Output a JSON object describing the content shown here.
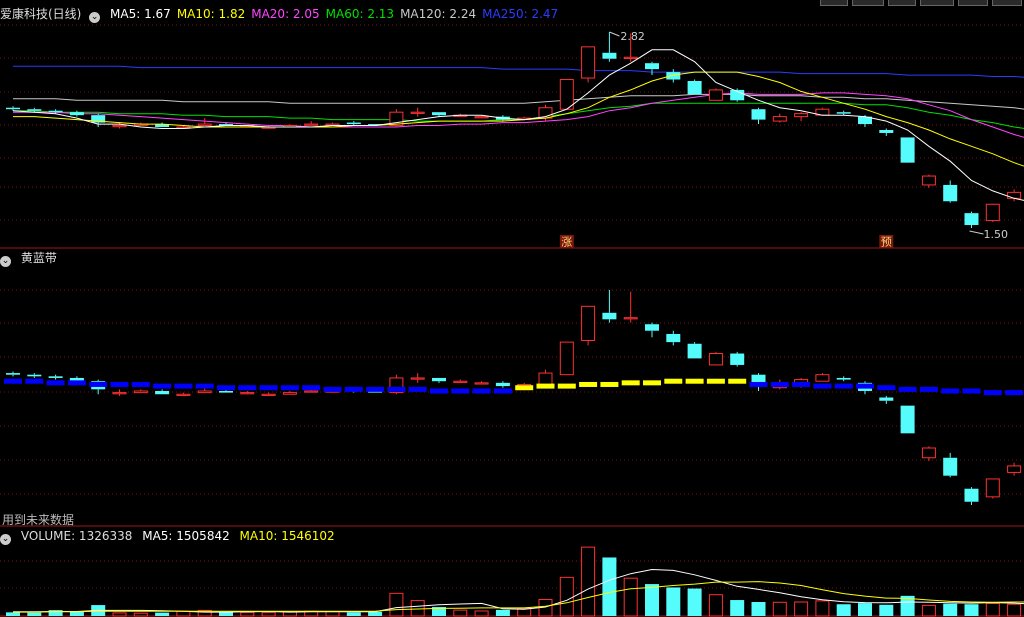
{
  "panel1": {
    "title": "爱康科技(日线)",
    "ma_labels": [
      {
        "label": "MA5: 1.67",
        "color": "#ffffff"
      },
      {
        "label": "MA10: 1.82",
        "color": "#ffff00"
      },
      {
        "label": "MA20: 2.05",
        "color": "#ff44ff"
      },
      {
        "label": "MA60: 2.13",
        "color": "#00e000"
      },
      {
        "label": "MA120: 2.24",
        "color": "#c8c8c8"
      },
      {
        "label": "MA250: 2.47",
        "color": "#2a3cff"
      }
    ],
    "high_label": "2.82",
    "low_label": "1.50",
    "tag_limit_up": "涨",
    "tag_forecast": "预"
  },
  "panel2": {
    "title": "黄蓝带",
    "footer_note": "用到未来数据"
  },
  "panel3": {
    "title": "VOLUME: 1326338",
    "ma5_label": "MA5: 1505842",
    "ma10_label": "MA10: 1546102"
  },
  "colors": {
    "up": "#ff3030",
    "down": "#54fcfc",
    "grid": "#7a1010",
    "ma5": "#ffffff",
    "ma10": "#ffff00",
    "ma20": "#ff44ff",
    "ma60": "#00e000",
    "ma120": "#c8c8c8",
    "ma250": "#2a3cff",
    "band_yellow": "#ffff00",
    "band_blue": "#0000ff"
  },
  "chart_data": {
    "type": "candlestick",
    "candles": [
      [
        2.31,
        2.3,
        2.32,
        2.29
      ],
      [
        2.3,
        2.29,
        2.31,
        2.28
      ],
      [
        2.29,
        2.28,
        2.3,
        2.27
      ],
      [
        2.28,
        2.26,
        2.29,
        2.25
      ],
      [
        2.26,
        2.21,
        2.27,
        2.18
      ],
      [
        2.19,
        2.19,
        2.21,
        2.17
      ],
      [
        2.19,
        2.2,
        2.21,
        2.19
      ],
      [
        2.2,
        2.18,
        2.21,
        2.18
      ],
      [
        2.18,
        2.18,
        2.19,
        2.18
      ],
      [
        2.19,
        2.2,
        2.24,
        2.19
      ],
      [
        2.2,
        2.19,
        2.21,
        2.19
      ],
      [
        2.19,
        2.19,
        2.2,
        2.18
      ],
      [
        2.18,
        2.18,
        2.19,
        2.17
      ],
      [
        2.18,
        2.19,
        2.2,
        2.18
      ],
      [
        2.2,
        2.2,
        2.22,
        2.2
      ],
      [
        2.2,
        2.2,
        2.21,
        2.19
      ],
      [
        2.21,
        2.2,
        2.22,
        2.19
      ],
      [
        2.2,
        2.19,
        2.2,
        2.19
      ],
      [
        2.19,
        2.28,
        2.3,
        2.18
      ],
      [
        2.28,
        2.28,
        2.31,
        2.25
      ],
      [
        2.28,
        2.26,
        2.28,
        2.25
      ],
      [
        2.26,
        2.26,
        2.27,
        2.25
      ],
      [
        2.25,
        2.25,
        2.26,
        2.24
      ],
      [
        2.25,
        2.23,
        2.26,
        2.22
      ],
      [
        2.23,
        2.24,
        2.25,
        2.23
      ],
      [
        2.24,
        2.31,
        2.33,
        2.22
      ],
      [
        2.3,
        2.5,
        2.5,
        2.3
      ],
      [
        2.51,
        2.72,
        2.72,
        2.48
      ],
      [
        2.68,
        2.64,
        2.82,
        2.62
      ],
      [
        2.65,
        2.65,
        2.81,
        2.62
      ],
      [
        2.61,
        2.57,
        2.62,
        2.53
      ],
      [
        2.55,
        2.5,
        2.57,
        2.48
      ],
      [
        2.49,
        2.4,
        2.5,
        2.4
      ],
      [
        2.36,
        2.43,
        2.44,
        2.36
      ],
      [
        2.43,
        2.36,
        2.44,
        2.35
      ],
      [
        2.3,
        2.23,
        2.31,
        2.2
      ],
      [
        2.22,
        2.25,
        2.27,
        2.21
      ],
      [
        2.25,
        2.27,
        2.28,
        2.22
      ],
      [
        2.26,
        2.3,
        2.31,
        2.26
      ],
      [
        2.28,
        2.27,
        2.29,
        2.26
      ],
      [
        2.25,
        2.2,
        2.26,
        2.18
      ],
      [
        2.16,
        2.14,
        2.17,
        2.12
      ],
      [
        2.11,
        1.94,
        2.11,
        1.94
      ],
      [
        1.79,
        1.85,
        1.86,
        1.77
      ],
      [
        1.79,
        1.68,
        1.82,
        1.67
      ],
      [
        1.6,
        1.52,
        1.61,
        1.5
      ],
      [
        1.55,
        1.66,
        1.66,
        1.54
      ],
      [
        1.7,
        1.74,
        1.76,
        1.68
      ],
      [
        1.82,
        1.79,
        1.84,
        1.77
      ]
    ],
    "ma5": [
      2.29,
      2.28,
      2.27,
      2.24,
      2.2,
      2.2,
      2.18,
      2.17,
      2.17,
      2.18,
      2.19,
      2.19,
      2.18,
      2.18,
      2.18,
      2.19,
      2.19,
      2.19,
      2.21,
      2.23,
      2.25,
      2.26,
      2.26,
      2.24,
      2.23,
      2.25,
      2.3,
      2.41,
      2.53,
      2.61,
      2.7,
      2.7,
      2.62,
      2.48,
      2.42,
      2.36,
      2.31,
      2.29,
      2.26,
      2.26,
      2.25,
      2.22,
      2.16,
      2.05,
      1.95,
      1.82,
      1.75,
      1.7,
      1.67
    ],
    "ma10": [
      2.25,
      2.25,
      2.24,
      2.23,
      2.22,
      2.21,
      2.2,
      2.2,
      2.19,
      2.18,
      2.18,
      2.18,
      2.18,
      2.18,
      2.18,
      2.18,
      2.19,
      2.19,
      2.2,
      2.21,
      2.22,
      2.22,
      2.22,
      2.22,
      2.23,
      2.24,
      2.27,
      2.31,
      2.38,
      2.43,
      2.49,
      2.53,
      2.55,
      2.55,
      2.55,
      2.52,
      2.48,
      2.42,
      2.38,
      2.34,
      2.3,
      2.25,
      2.21,
      2.16,
      2.1,
      2.05,
      2.0,
      1.94,
      1.89
    ],
    "ma20": [
      2.28,
      2.28,
      2.28,
      2.27,
      2.27,
      2.26,
      2.25,
      2.24,
      2.23,
      2.22,
      2.21,
      2.2,
      2.19,
      2.19,
      2.18,
      2.18,
      2.18,
      2.18,
      2.18,
      2.19,
      2.19,
      2.2,
      2.2,
      2.21,
      2.21,
      2.22,
      2.23,
      2.25,
      2.29,
      2.31,
      2.34,
      2.36,
      2.38,
      2.4,
      2.41,
      2.4,
      2.4,
      2.4,
      2.41,
      2.41,
      2.4,
      2.39,
      2.37,
      2.33,
      2.29,
      2.23,
      2.18,
      2.13,
      2.09
    ],
    "ma60": [
      2.29,
      2.29,
      2.28,
      2.28,
      2.28,
      2.27,
      2.27,
      2.27,
      2.26,
      2.26,
      2.25,
      2.25,
      2.25,
      2.24,
      2.24,
      2.23,
      2.23,
      2.23,
      2.23,
      2.22,
      2.22,
      2.22,
      2.22,
      2.23,
      2.23,
      2.25,
      2.27,
      2.29,
      2.31,
      2.32,
      2.34,
      2.34,
      2.34,
      2.34,
      2.34,
      2.34,
      2.34,
      2.34,
      2.34,
      2.34,
      2.33,
      2.33,
      2.31,
      2.28,
      2.26,
      2.23,
      2.21,
      2.18,
      2.16
    ],
    "ma120": [
      2.37,
      2.37,
      2.37,
      2.36,
      2.36,
      2.36,
      2.36,
      2.36,
      2.35,
      2.35,
      2.35,
      2.35,
      2.35,
      2.34,
      2.34,
      2.34,
      2.34,
      2.34,
      2.34,
      2.34,
      2.34,
      2.34,
      2.34,
      2.34,
      2.34,
      2.35,
      2.36,
      2.37,
      2.38,
      2.39,
      2.39,
      2.39,
      2.4,
      2.4,
      2.4,
      2.39,
      2.39,
      2.39,
      2.38,
      2.38,
      2.37,
      2.37,
      2.36,
      2.35,
      2.34,
      2.33,
      2.32,
      2.31,
      2.29
    ],
    "ma250": [
      2.59,
      2.59,
      2.59,
      2.59,
      2.59,
      2.59,
      2.58,
      2.58,
      2.58,
      2.58,
      2.58,
      2.58,
      2.58,
      2.58,
      2.58,
      2.58,
      2.58,
      2.58,
      2.58,
      2.58,
      2.58,
      2.58,
      2.58,
      2.57,
      2.57,
      2.57,
      2.57,
      2.56,
      2.56,
      2.56,
      2.55,
      2.55,
      2.55,
      2.55,
      2.55,
      2.55,
      2.55,
      2.54,
      2.54,
      2.54,
      2.54,
      2.54,
      2.53,
      2.53,
      2.53,
      2.53,
      2.52,
      2.52,
      2.51
    ],
    "band_level": [
      2.26,
      2.26,
      2.25,
      2.25,
      2.24,
      2.24,
      2.24,
      2.23,
      2.23,
      2.23,
      2.22,
      2.22,
      2.22,
      2.22,
      2.22,
      2.21,
      2.21,
      2.21,
      2.21,
      2.21,
      2.2,
      2.2,
      2.2,
      2.2,
      2.22,
      2.23,
      2.23,
      2.24,
      2.24,
      2.25,
      2.25,
      2.26,
      2.26,
      2.26,
      2.26,
      2.24,
      2.24,
      2.24,
      2.23,
      2.23,
      2.23,
      2.22,
      2.21,
      2.21,
      2.2,
      2.2,
      2.19,
      2.19,
      2.18
    ],
    "band_color": [
      "b",
      "b",
      "b",
      "b",
      "b",
      "b",
      "b",
      "b",
      "b",
      "b",
      "b",
      "b",
      "b",
      "b",
      "b",
      "b",
      "b",
      "b",
      "b",
      "b",
      "b",
      "b",
      "b",
      "b",
      "y",
      "y",
      "y",
      "y",
      "y",
      "y",
      "y",
      "y",
      "y",
      "y",
      "y",
      "b",
      "b",
      "b",
      "b",
      "b",
      "b",
      "b",
      "b",
      "b",
      "b",
      "b",
      "b",
      "b",
      "b"
    ],
    "volume": [
      130000,
      120000,
      210000,
      150000,
      390000,
      110000,
      100000,
      120000,
      170000,
      200000,
      140000,
      130000,
      130000,
      150000,
      170000,
      160000,
      130000,
      150000,
      810000,
      550000,
      320000,
      210000,
      180000,
      220000,
      270000,
      590000,
      1380000,
      2460000,
      2090000,
      1350000,
      1140000,
      1020000,
      980000,
      760000,
      570000,
      500000,
      490000,
      500000,
      540000,
      420000,
      460000,
      400000,
      720000,
      380000,
      440000,
      420000,
      450000,
      420000,
      360000
    ],
    "vol_ma5": [
      150000,
      150000,
      160000,
      160000,
      200000,
      200000,
      200000,
      190000,
      170000,
      140000,
      140000,
      150000,
      160000,
      140000,
      150000,
      150000,
      150000,
      150000,
      300000,
      350000,
      400000,
      430000,
      450000,
      260000,
      240000,
      320000,
      560000,
      960000,
      1280000,
      1510000,
      1660000,
      1630000,
      1470000,
      1270000,
      1060000,
      950000,
      830000,
      690000,
      580000,
      510000,
      480000,
      470000,
      500000,
      490000,
      470000,
      460000,
      480000,
      460000,
      420000
    ],
    "vol_ma10": [
      140000,
      140000,
      150000,
      150000,
      170000,
      170000,
      170000,
      170000,
      170000,
      170000,
      170000,
      170000,
      170000,
      170000,
      170000,
      170000,
      170000,
      170000,
      230000,
      250000,
      270000,
      280000,
      290000,
      290000,
      290000,
      350000,
      470000,
      660000,
      840000,
      970000,
      1020000,
      1090000,
      1140000,
      1210000,
      1210000,
      1230000,
      1180000,
      1090000,
      940000,
      800000,
      710000,
      640000,
      630000,
      570000,
      520000,
      500000,
      490000,
      500000,
      500000
    ]
  }
}
